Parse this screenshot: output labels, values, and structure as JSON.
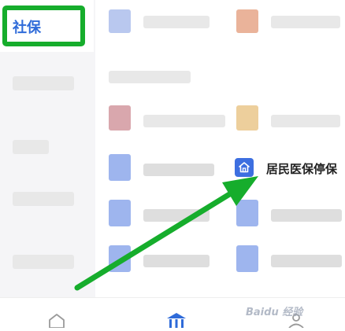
{
  "sidebar": {
    "selected_label": "社保"
  },
  "service": {
    "label": "居民医保停保",
    "icon": "home-icon"
  },
  "tabbar": {
    "items": [
      "home-icon",
      "bank-icon",
      "profile-icon"
    ]
  },
  "watermark": "Baidu 经验",
  "annotation": {
    "highlight_color": "#16ad2c",
    "arrow_color": "#16ad2c"
  },
  "colors": {
    "accent": "#2f6bd9",
    "service_icon": "#3d6fe0"
  }
}
